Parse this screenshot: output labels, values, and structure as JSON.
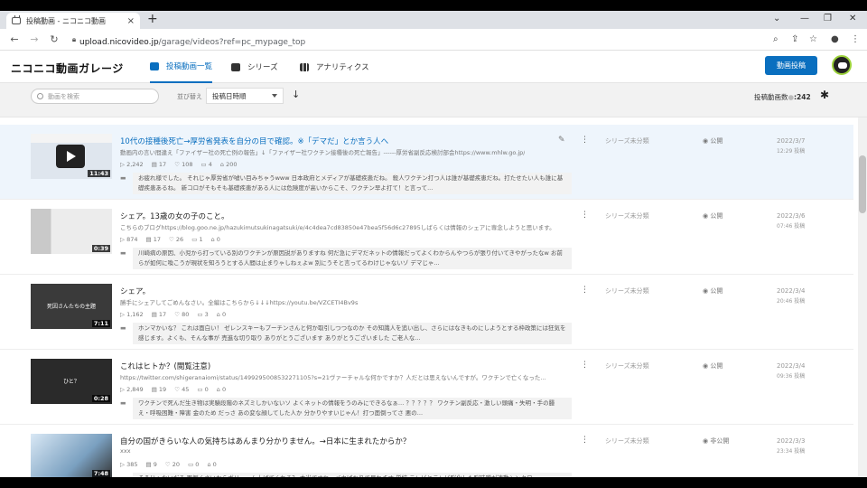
{
  "browser": {
    "tab_title": "投稿動画 - ニコニコ動画",
    "tab_close": "×",
    "new_tab": "+",
    "url_host": "upload.nicovideo.jp",
    "url_path": "/garage/videos?ref=pc_mypage_top"
  },
  "header": {
    "logo": "ニコニコ動画ガレージ",
    "tabs": [
      {
        "label": "投稿動画一覧",
        "active": true
      },
      {
        "label": "シリーズ"
      },
      {
        "label": "アナリティクス"
      }
    ],
    "post_button": "動画投稿"
  },
  "toolbar": {
    "search_placeholder": "動画を検索",
    "sort_label": "並び替え",
    "sort_value": "投稿日時順",
    "sort_direction": "↓",
    "count_label": "投稿動画数",
    "count_value": ":242"
  },
  "videos": [
    {
      "title": "10代の接種後死亡→厚労省発表を自分の目で確認。※「デマだ」とか言う人へ",
      "desc": "動画内の言い間違え「ファイザー社の死亡例の報告」↓「ファイザー社ワクチン接種後の死亡報告」------厚労省副反応検討部会https://www.mhlw.go.jp/",
      "duration": "11:43",
      "views": "2,242",
      "comments": "17",
      "mylists": "108",
      "likes": "4",
      "gifts": "200",
      "comment": "お疲れ様でした。 それじゃ厚労省が嘘い目みちゃうwww 日本政府とメディアが基礎疾患だね。 殺人ワクチン打つ人は誰が基礎疾患だね。打たせたい人も誰に基礎疾患あるね。 新コロがそもそも基礎疾患がある人には危険度が高いからこそ、ワクチン早よ打て！と言って...",
      "series": "シリーズ未分類",
      "visibility": "公開",
      "date": "2022/3/7",
      "time": "12:29 投稿"
    },
    {
      "title": "シェア。13歳の女の子のこと。",
      "desc": "こちらのブログhttps://blog.goo.ne.jp/hazukimutsukinagatsuki/e/4c4dea7cd83850e47bea5f56d6c27895しばらくは情報のシェアに専念しようと思います。",
      "duration": "0:39",
      "views": "874",
      "comments": "17",
      "mylists": "26",
      "likes": "1",
      "gifts": "0",
      "comment": "川崎病の原因、小児から打っている別のワクチンが原因説がありますね 何だ急にデマだネットの情報だってよくわからんやつらが張り付いてきやがったなw お前らが如何に喚こうが現状を知ろうとする人間は止まりゃしねぇよw 別にうそと言ってるわけじゃないゾ デマじゃ...",
      "series": "シリーズ未分類",
      "visibility": "公開",
      "date": "2022/3/6",
      "time": "07:46 投稿"
    },
    {
      "title": "シェア。",
      "desc": "勝手にシェアしてごめんなさい。全編はこちらから↓↓↓https://youtu.be/VZCETI4Bv9s",
      "duration": "7:11",
      "thumb_text": "死因さんたちの主題",
      "views": "1,162",
      "comments": "17",
      "mylists": "80",
      "likes": "3",
      "gifts": "0",
      "comment": "ホンマかいな？ これは面白い！ ゼレンスキーもプーチンさんと何か取引しつつなのか その知識人を追い出し、さらにはなきものにしようとする枠政策には狂気を感じます。よくも、そんな事が 売進な切り取り ありがとうございます ありがとうございました ご老人な...",
      "series": "シリーズ未分類",
      "visibility": "公開",
      "date": "2022/3/4",
      "time": "20:46 投稿"
    },
    {
      "title": "これはヒトか？(閲覧注意)",
      "desc": "https://twitter.com/shigeranaiomi/status/1499295008532271105?s=21ヴァーチャルな何かですか？人だとは思えないんですが。ワクチンで亡くなった...",
      "duration": "0:28",
      "thumb_text": "ひと？",
      "views": "2,849",
      "comments": "19",
      "mylists": "45",
      "likes": "0",
      "gifts": "0",
      "comment": "ワクチンで死んだ生き物は実験段階のネズミしかいないソ よくネットの情報をうのみにできるなぁ… ？？？？？ ワクチン副反応・激しい頭痛・失明・手の腫え・呼吸困難・障害 金のため だっさ あの変な顔してした人か 分かりやすいじゃん！打つ面倒ってさ 悪の...",
      "series": "シリーズ未分類",
      "visibility": "公開",
      "date": "2022/3/4",
      "time": "09:36 投稿"
    },
    {
      "title": "自分の国がきらいな人の気持ちはあんまり分かりません。→日本に生まれたからか？",
      "desc": "xxx",
      "duration": "7:48",
      "views": "385",
      "comments": "9",
      "mylists": "20",
      "likes": "0",
      "gifts": "0",
      "comment": "そうじゃないだろ 面倒くさいからボリューム上げてくれる？ 本当ですね、バカばかりで呆れます 単純 テレビとテレビ脳化した脳味噌が連動シンクロ",
      "series": "シリーズ未分類",
      "visibility": "非公開",
      "date": "2022/3/3",
      "time": "23:34 投稿"
    }
  ],
  "colors": {
    "accent": "#0a6fbf",
    "highlight_row": "#eef5fc"
  }
}
